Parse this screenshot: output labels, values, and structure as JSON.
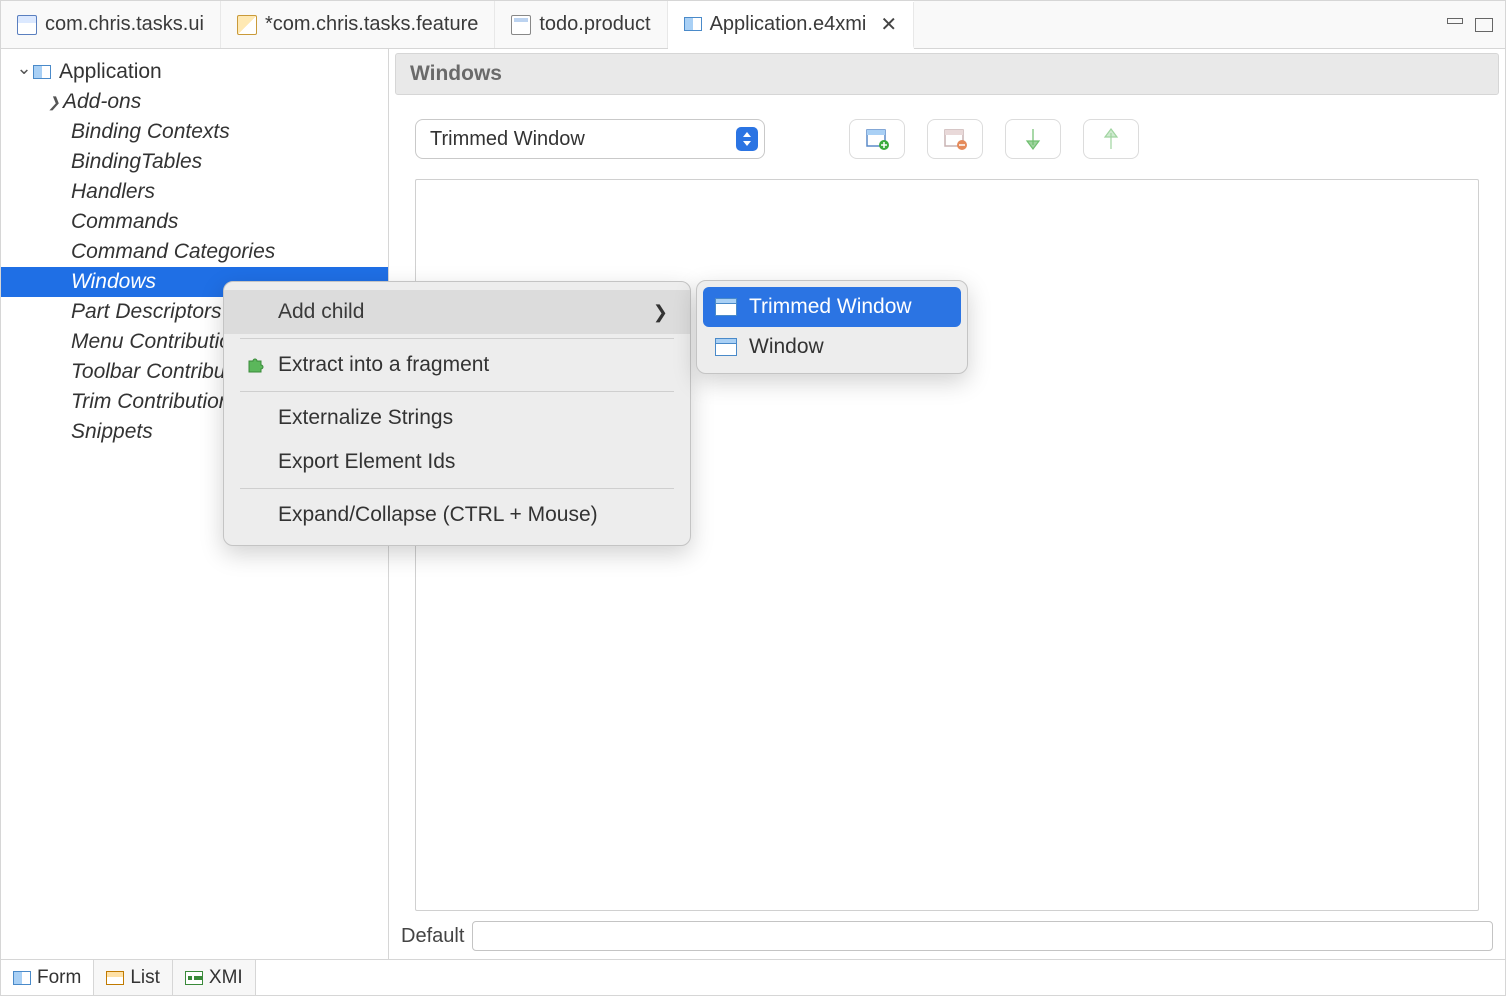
{
  "tabs": [
    {
      "label": "com.chris.tasks.ui"
    },
    {
      "label": "*com.chris.tasks.feature"
    },
    {
      "label": "todo.product"
    },
    {
      "label": "Application.e4xmi"
    }
  ],
  "tree": {
    "root": "Application",
    "children": [
      "Add-ons",
      "Binding Contexts",
      "BindingTables",
      "Handlers",
      "Commands",
      "Command Categories",
      "Windows",
      "Part Descriptors",
      "Menu Contributions",
      "Toolbar Contributions",
      "Trim Contributions",
      "Snippets"
    ],
    "selected_index": 6
  },
  "section_title": "Windows",
  "combo_value": "Trimmed Window",
  "bottom_label": "Default",
  "bottom_tabs": [
    "Form",
    "List",
    "XMI"
  ],
  "context_menu": {
    "items": [
      {
        "label": "Add child",
        "has_submenu": true,
        "highlighted": true
      },
      {
        "separator": true
      },
      {
        "label": "Extract into a fragment",
        "icon": "puzzle"
      },
      {
        "separator": true
      },
      {
        "label": "Externalize Strings"
      },
      {
        "label": "Export Element Ids"
      },
      {
        "separator": true
      },
      {
        "label": "Expand/Collapse (CTRL + Mouse)"
      }
    ],
    "submenu": [
      {
        "label": "Trimmed Window",
        "selected": true
      },
      {
        "label": "Window"
      }
    ]
  }
}
